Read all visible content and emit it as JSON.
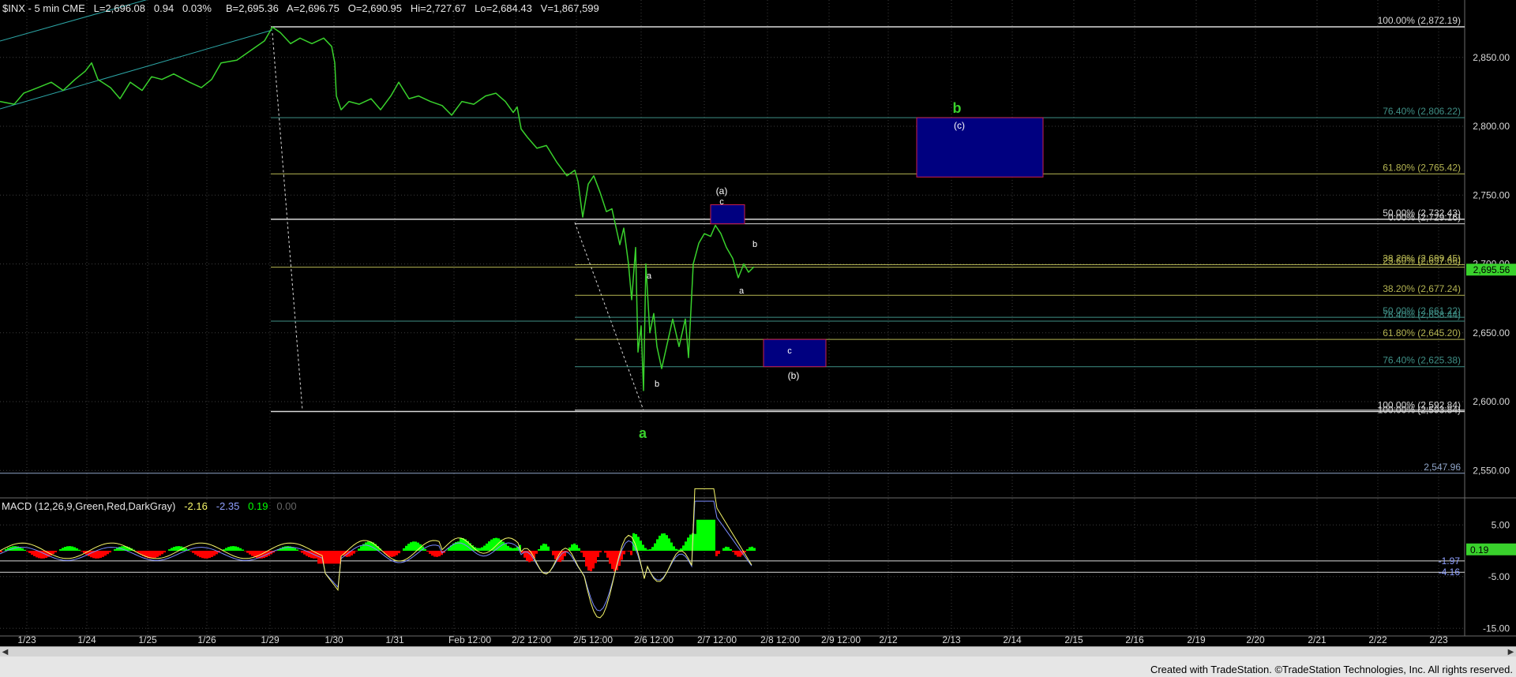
{
  "header": {
    "symbol": "$INX - 5 min  CME",
    "last": "L=2,696.08",
    "change": "0.94",
    "change_pct": "0.03%",
    "bid": "B=2,695.36",
    "ask": "A=2,696.75",
    "open": "O=2,690.95",
    "high": "Hi=2,727.67",
    "low": "Lo=2,684.43",
    "volume": "V=1,867,599"
  },
  "macd": {
    "label": "MACD (12,26,9,Green,Red,DarkGray)",
    "v1": "-2.16",
    "v2": "-2.35",
    "v3": "0.19",
    "v4": "0.00",
    "right_tags": [
      "-1.97",
      "-4.16"
    ],
    "current_tag": "0.19",
    "axis_labels": [
      "5.00",
      "-5.00",
      "-15.00"
    ]
  },
  "price_axis": {
    "labels": [
      "2,850.00",
      "2,800.00",
      "2,750.00",
      "2,700.00",
      "2,650.00",
      "2,600.00",
      "2,550.00"
    ],
    "current_tag": "2,695.56"
  },
  "date_axis": [
    "1/23",
    "1/24",
    "1/25",
    "1/26",
    "1/29",
    "1/30",
    "1/31",
    "Feb 12:00",
    "2/2 12:00",
    "2/5 12:00",
    "2/6 12:00",
    "2/7 12:00",
    "2/8 12:00",
    "2/9 12:00",
    "2/12",
    "2/13",
    "2/14",
    "2/15",
    "2/16",
    "2/19",
    "2/20",
    "2/21",
    "2/22",
    "2/23"
  ],
  "fib_labels": {
    "top100": "100.00% (2,872.19)",
    "f764_upper": "76.40% (2,806.22)",
    "f618_upper": "61.80% (2,765.42)",
    "f50_upper": "50.00% (2,732.43)",
    "f0_small": "0.00% (2,729.16)",
    "f382_a": "38.20% (2,699.45)",
    "f236_a": "23.60% (2,697.66)",
    "f382_b": "38.20% (2,677.24)",
    "f50_b": "50.00% (2,661.22)",
    "f764_small": "76.40% (2,658.44)",
    "f618_b": "61.80% (2,645.20)",
    "f764_b": "76.40% (2,625.38)",
    "bot100": "100.00% (2,592.84)",
    "bot100_small": "100.00% (2,593.84)",
    "level_2547": "2,547.96"
  },
  "wave_labels": {
    "big_a": "a",
    "big_b": "b",
    "c_paren": "(c)",
    "a_paren": "(a)",
    "b_paren": "(b)",
    "small_c_top": "c",
    "small_c_box": "c",
    "small_a1": "a",
    "small_b1": "b",
    "small_a2": "a",
    "small_b2": "b"
  },
  "colors": {
    "price_line": "#39d12c",
    "fib_olive": "#b5b552",
    "fib_teal": "#3f8f86",
    "fib_white": "#d9d9d9",
    "box_fill": "#000080",
    "box_border": "#cc1f4e",
    "macd_fast": "#f7f76a",
    "macd_slow": "#7b8cff",
    "hist_pos": "#00ff00",
    "hist_neg": "#ff0000"
  },
  "chart_data": {
    "type": "line",
    "title": "$INX - 5 min  CME",
    "xlabel": "",
    "ylabel": "",
    "ylim": [
      2540,
      2880
    ],
    "x": [
      "1/23",
      "1/24",
      "1/25",
      "1/26",
      "1/29",
      "1/30",
      "1/31",
      "Feb 12:00",
      "2/2 12:00",
      "2/5 12:00",
      "2/6 12:00",
      "2/7 12:00"
    ],
    "series": [
      {
        "name": "$INX",
        "values": [
          2830,
          2845,
          2838,
          2852,
          2870,
          2820,
          2822,
          2818,
          2775,
          2705,
          2620,
          2710
        ]
      }
    ],
    "fib_levels": [
      2872.19,
      2806.22,
      2765.42,
      2732.43,
      2729.16,
      2699.45,
      2697.66,
      2677.24,
      2661.22,
      2658.44,
      2645.2,
      2625.38,
      2593.84,
      2592.84,
      2547.96
    ],
    "macd_ylim": [
      -18,
      8
    ],
    "footer": "Created with TradeStation. ©TradeStation Technologies, Inc. All rights reserved."
  }
}
